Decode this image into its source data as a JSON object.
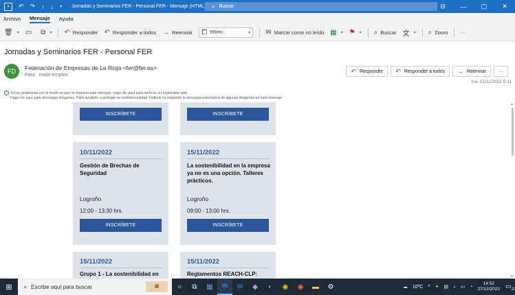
{
  "titlebar": {
    "title": "Jornadas y Seminarios FER - Personal FER  -  Mensaje (HTML)",
    "search_placeholder": "Buscar",
    "window_controls": [
      "⊟",
      "—",
      "▢",
      "✕"
    ]
  },
  "menu": {
    "items": [
      "Archivo",
      "Mensaje",
      "Ayuda"
    ],
    "active": "Mensaje"
  },
  "ribbon": {
    "reply": "Responder",
    "reply_all": "Responder a todos",
    "forward": "Reenviar",
    "move_to": "RRHH",
    "mark_unread": "Marcar como no leído",
    "search": "Buscar",
    "zoom": "Zoom",
    "more": "···"
  },
  "message": {
    "subject": "Jornadas y Seminarios FER - Personal FER",
    "avatar_initials": "FD",
    "sender": "Federación de Empresas de La Rioja <fer@fer.es>",
    "to_label": "Para",
    "to_value": "maite.empleo",
    "date": "ma. 01/11/2022 5:11",
    "actions": {
      "reply": "Responder",
      "reply_all": "Responder a todos",
      "forward": "Reenviar",
      "more": "···"
    },
    "info_line1": "Si hay problemas con el modo en que se muestra este mensaje, haga clic aquí para verlo en un explorador web.",
    "info_line2": "Haga clic aquí para descargar imágenes. Para ayudarle a proteger su confidencialidad, Outlook ha impedido la descarga automática de algunas imágenes en este mensaje."
  },
  "email_body": {
    "button_label": "INSCRÍBETE",
    "events": [
      {
        "date": "10/11/2022",
        "title": "Gestión de Brechas de Seguridad",
        "place": "Logroño",
        "time": "12:00 - 13:30 hrs."
      },
      {
        "date": "15/11/2022",
        "title": "La sostenibilidad en la empresa ya no es una opción. Talleres prácticos.",
        "place": "Logroño",
        "time": "09:00 - 13:00 hrs."
      },
      {
        "date": "15/11/2022",
        "title": "Grupo 1 - La sostenibilidad en"
      },
      {
        "date": "15/11/2022",
        "title": "Reglamentos REACH-CLP:"
      }
    ]
  },
  "taskbar": {
    "search_placeholder": "Escribe aquí para buscar",
    "weather": "10ºC",
    "time": "14:52",
    "date": "27/12/2022",
    "notifications": "21"
  }
}
